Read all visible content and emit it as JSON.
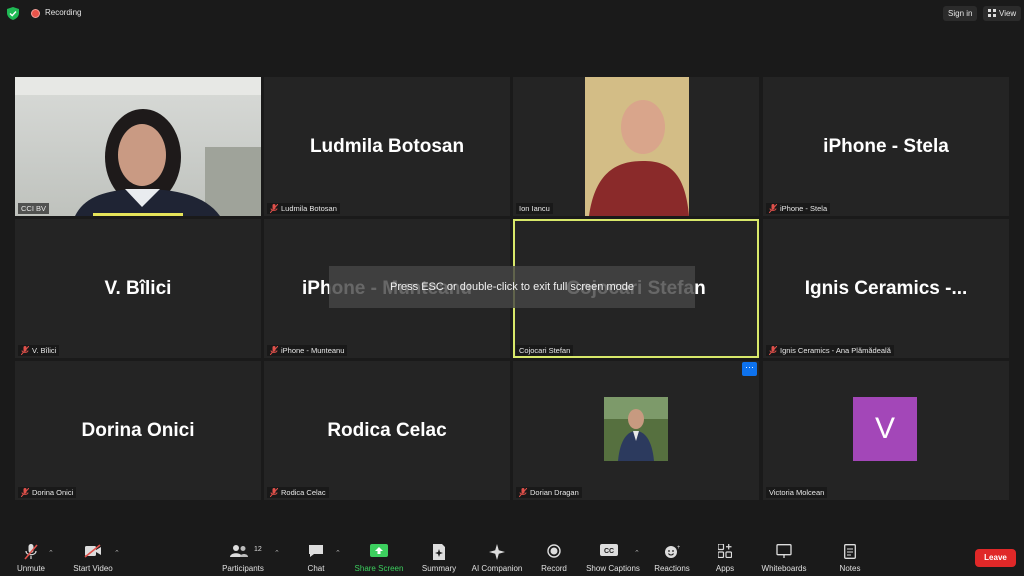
{
  "topbar": {
    "recording_label": "Recording",
    "sign_in_label": "Sign in",
    "view_label": "View"
  },
  "overlay_message": "Press ESC or double-click to exit full screen mode",
  "participants": [
    {
      "display": "",
      "name": "CCI BV",
      "muted": false,
      "video": true
    },
    {
      "display": "Ludmila Botosan",
      "name": "Ludmila Botosan",
      "muted": true,
      "video": false
    },
    {
      "display": "",
      "name": "Ion Iancu",
      "muted": false,
      "video": true
    },
    {
      "display": "iPhone - Stela",
      "name": "iPhone - Stela",
      "muted": true,
      "video": false
    },
    {
      "display": "V. Bîlici",
      "name": "V. Bîlici",
      "muted": true,
      "video": false
    },
    {
      "display": "iPhone - Munteanu",
      "name": "iPhone - Munteanu",
      "muted": true,
      "video": false
    },
    {
      "display": "Cojocari Stefan",
      "name": "Cojocari Stefan",
      "muted": false,
      "video": false,
      "active_speaker": true
    },
    {
      "display": "Ignis Ceramics -...",
      "name": "Ignis Ceramics - Ana Plămădeală",
      "muted": true,
      "video": false
    },
    {
      "display": "Dorina Onici",
      "name": "Dorina Onici",
      "muted": true,
      "video": false
    },
    {
      "display": "Rodica Celac",
      "name": "Rodica Celac",
      "muted": true,
      "video": false
    },
    {
      "display": "",
      "name": "Dorian Dragan",
      "muted": true,
      "video": false,
      "avatar_photo": true
    },
    {
      "display": "",
      "name": "Victoria Molcean",
      "muted": false,
      "video": false,
      "avatar_letter": "V"
    }
  ],
  "more_button": "···",
  "toolbar": {
    "unmute": "Unmute",
    "start_video": "Start Video",
    "participants": "Participants",
    "participants_count": "12",
    "chat": "Chat",
    "share_screen": "Share Screen",
    "summary": "Summary",
    "ai_companion": "AI Companion",
    "record": "Record",
    "show_captions": "Show Captions",
    "reactions": "Reactions",
    "apps": "Apps",
    "whiteboards": "Whiteboards",
    "notes": "Notes",
    "leave": "Leave"
  },
  "colors": {
    "background": "#1a1a1a",
    "tile": "#242424",
    "active_speaker_border": "#d8e86a",
    "share_green": "#3ccf5e",
    "leave_red": "#e02828",
    "muted_red": "#e0504a",
    "avatar_purple": "#a347b8"
  }
}
